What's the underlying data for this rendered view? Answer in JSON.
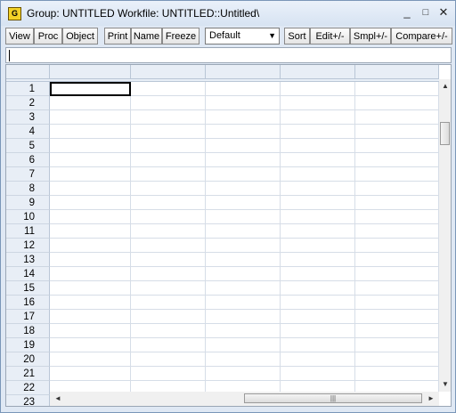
{
  "window": {
    "icon_letter": "G",
    "title": "Group: UNTITLED   Workfile: UNTITLED::Untitled\\"
  },
  "toolbar": {
    "buttons": [
      "View",
      "Proc",
      "Object",
      "Print",
      "Name",
      "Freeze"
    ],
    "display_select": "Default",
    "buttons_right": [
      "Sort",
      "Edit+/-",
      "Smpl+/-",
      "Compare+/-"
    ]
  },
  "edit_line": {
    "value": ""
  },
  "grid": {
    "rows": [
      "1",
      "2",
      "3",
      "4",
      "5",
      "6",
      "7",
      "8",
      "9",
      "10",
      "11",
      "12",
      "13",
      "14",
      "15",
      "16",
      "17",
      "18",
      "19",
      "20",
      "21",
      "22",
      "23"
    ],
    "selected_cell": {
      "row": "1",
      "col": 1
    }
  },
  "hscroll_grip": "|||"
}
